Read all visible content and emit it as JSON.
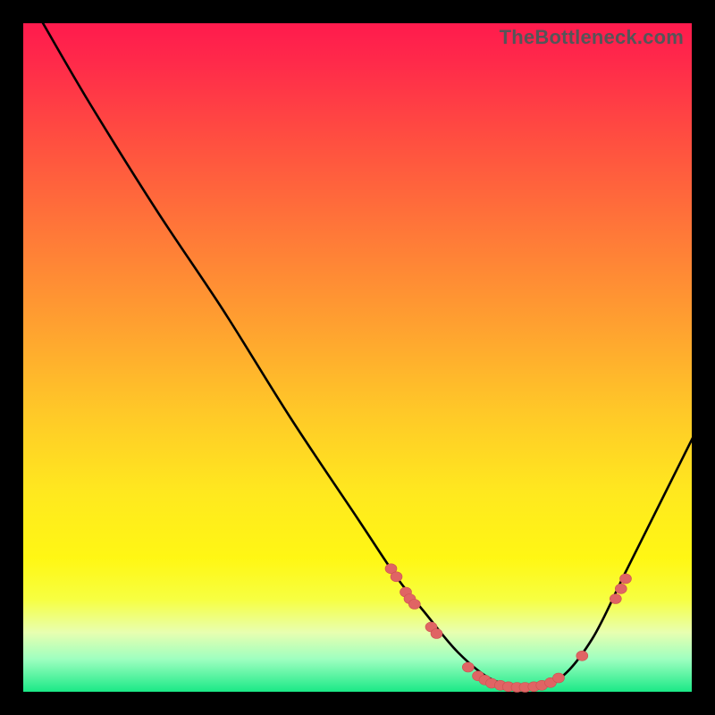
{
  "watermark": "TheBottleneck.com",
  "chart_data": {
    "type": "line",
    "title": "",
    "xlabel": "",
    "ylabel": "",
    "xlim": [
      0,
      100
    ],
    "ylim": [
      0,
      100
    ],
    "series": [
      {
        "name": "curve",
        "x": [
          3,
          10,
          20,
          30,
          40,
          50,
          56,
          60,
          65,
          70,
          75,
          80,
          85,
          90,
          96,
          100
        ],
        "y": [
          100,
          88,
          72,
          57,
          41,
          26,
          17,
          12,
          6,
          2,
          1,
          2,
          8,
          18,
          30,
          38
        ]
      }
    ],
    "points": [
      {
        "x": 55.0,
        "y": 18.5
      },
      {
        "x": 55.8,
        "y": 17.3
      },
      {
        "x": 57.2,
        "y": 15.0
      },
      {
        "x": 57.8,
        "y": 14.0
      },
      {
        "x": 58.5,
        "y": 13.2
      },
      {
        "x": 61.0,
        "y": 9.8
      },
      {
        "x": 61.8,
        "y": 8.8
      },
      {
        "x": 66.5,
        "y": 3.8
      },
      {
        "x": 68.0,
        "y": 2.5
      },
      {
        "x": 69.0,
        "y": 1.9
      },
      {
        "x": 70.0,
        "y": 1.4
      },
      {
        "x": 71.3,
        "y": 1.1
      },
      {
        "x": 72.5,
        "y": 0.9
      },
      {
        "x": 73.8,
        "y": 0.8
      },
      {
        "x": 75.0,
        "y": 0.8
      },
      {
        "x": 76.3,
        "y": 0.9
      },
      {
        "x": 77.5,
        "y": 1.1
      },
      {
        "x": 78.8,
        "y": 1.5
      },
      {
        "x": 80.0,
        "y": 2.2
      },
      {
        "x": 83.5,
        "y": 5.5
      },
      {
        "x": 88.5,
        "y": 14.0
      },
      {
        "x": 89.3,
        "y": 15.5
      },
      {
        "x": 90.0,
        "y": 17.0
      }
    ],
    "colors": {
      "curve": "#000000",
      "point": "#e06464",
      "gradient_top": "#ff1a4d",
      "gradient_bottom": "#17e885"
    }
  }
}
